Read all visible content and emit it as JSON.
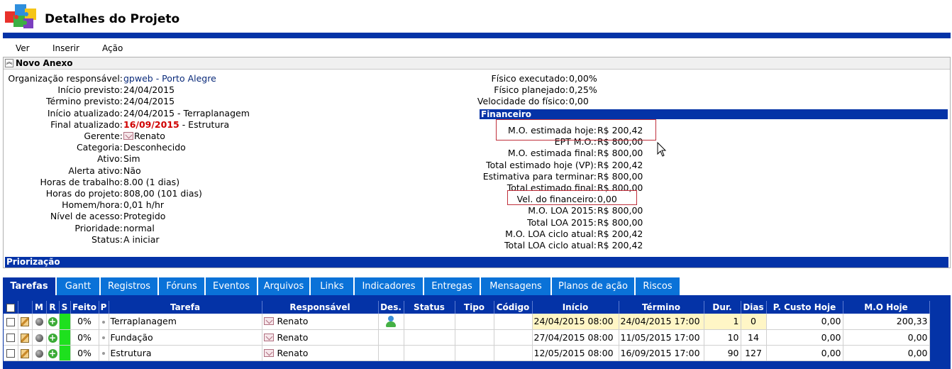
{
  "page": {
    "title": "Detalhes do Projeto"
  },
  "colors": {
    "accent": "#0433a7",
    "tab": "#0a72d8",
    "highlight_box": "#c0303c",
    "date_emph": "#d00000",
    "status_green": "#1ee01e",
    "yellow_cell": "#fff6c6"
  },
  "menu": {
    "items": [
      "Ver",
      "Inserir",
      "Ação"
    ]
  },
  "anexo": {
    "label": "Novo Anexo"
  },
  "left_fields": [
    {
      "label": "Organização responsável:",
      "value": "gpweb - Porto Alegre"
    },
    {
      "label": "Início previsto:",
      "value": "24/04/2015"
    },
    {
      "label": "Término previsto:",
      "value": "24/04/2015"
    },
    {
      "label": "Início atualizado:",
      "value": "24/04/2015 - Terraplanagem"
    },
    {
      "label": "Final atualizado:",
      "value_date": "16/09/2015",
      "value_rest": " - Estrutura"
    },
    {
      "label": "Gerente:",
      "value": "Renato"
    },
    {
      "label": "Categoria:",
      "value": "Desconhecido"
    },
    {
      "label": "Ativo:",
      "value": "Sim"
    },
    {
      "label": "Alerta ativo:",
      "value": "Não"
    },
    {
      "label": "Horas de trabalho:",
      "value": "8.00 (1 dias)"
    },
    {
      "label": "Horas do projeto:",
      "value": "808,00 (101 dias)"
    },
    {
      "label": "Homem/hora:",
      "value": "0,01 h/hr"
    },
    {
      "label": "Nível de acesso:",
      "value": "Protegido"
    },
    {
      "label": "Prioridade:",
      "value": "normal"
    },
    {
      "label": "Status:",
      "value": "A iniciar"
    }
  ],
  "right_physical": [
    {
      "label": "Físico executado:",
      "value": "0,00%"
    },
    {
      "label": "Físico planejado:",
      "value": "0,25%"
    },
    {
      "label": "Velocidade do físico:",
      "value": "0,00"
    }
  ],
  "financeiro": {
    "title": "Financeiro",
    "fields": [
      {
        "label": "M.O. estimada hoje:",
        "value": "R$ 200,42"
      },
      {
        "label": "EPT M.O.:",
        "value": "R$ 800,00"
      },
      {
        "label": "M.O. estimada final:",
        "value": "R$ 800,00"
      },
      {
        "label": "Total estimado hoje (VP):",
        "value": "R$ 200,42"
      },
      {
        "label": "Estimativa para terminar:",
        "value": "R$ 800,00"
      },
      {
        "label": "Total estimado final:",
        "value": "R$ 800,00"
      },
      {
        "label": "Vel. do financeiro:",
        "value": "0,00"
      },
      {
        "label": "M.O. LOA 2015:",
        "value": "R$ 800,00"
      },
      {
        "label": "Total LOA 2015:",
        "value": "R$ 800,00"
      },
      {
        "label": "M.O. LOA ciclo atual:",
        "value": "R$ 200,42"
      },
      {
        "label": "Total LOA ciclo atual:",
        "value": "R$ 200,42"
      }
    ]
  },
  "priorizacao": {
    "title": "Priorização"
  },
  "tabs": [
    "Tarefas",
    "Gantt",
    "Registros",
    "Fóruns",
    "Eventos",
    "Arquivos",
    "Links",
    "Indicadores",
    "Entregas",
    "Mensagens",
    "Planos de ação",
    "Riscos"
  ],
  "tasks_table": {
    "headers": [
      "",
      "",
      "M",
      "R",
      "S",
      "Feito",
      "P",
      "Tarefa",
      "Responsável",
      "Des.",
      "Status",
      "Tipo",
      "Código",
      "Início",
      "Término",
      "Dur.",
      "Dias",
      "P. Custo Hoje",
      "M.O Hoje"
    ],
    "rows": [
      {
        "feito": "0%",
        "tarefa": "Terraplanagem",
        "responsavel": "Renato",
        "inicio": "24/04/2015 08:00",
        "termino": "24/04/2015 17:00",
        "dur": "1",
        "dias": "0",
        "custo": "0,00",
        "mo": "200,33"
      },
      {
        "feito": "0%",
        "tarefa": "Fundação",
        "responsavel": "Renato",
        "inicio": "27/04/2015 08:00",
        "termino": "11/05/2015 17:00",
        "dur": "10",
        "dias": "14",
        "custo": "0,00",
        "mo": "0,00"
      },
      {
        "feito": "0%",
        "tarefa": "Estrutura",
        "responsavel": "Renato",
        "inicio": "12/05/2015 08:00",
        "termino": "16/09/2015 17:00",
        "dur": "90",
        "dias": "127",
        "custo": "0,00",
        "mo": "0,00"
      }
    ]
  }
}
